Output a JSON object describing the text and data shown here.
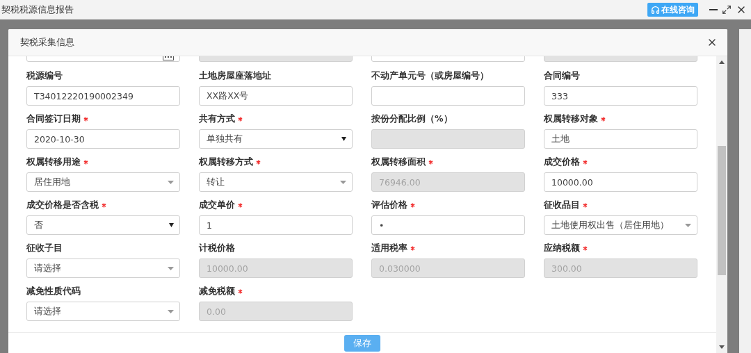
{
  "window": {
    "title": "契税税源信息报告",
    "consult_button": "在线咨询"
  },
  "dialog": {
    "title": "契税采集信息",
    "cut_off_fields": [
      {
        "kind": "date",
        "disabled": false
      },
      {
        "kind": "text",
        "disabled": true
      },
      {
        "kind": "text",
        "disabled": false
      },
      {
        "kind": "text",
        "disabled": true
      }
    ],
    "fields": [
      {
        "label": "税源编号",
        "required": false,
        "kind": "text",
        "value": "T34012220190002349",
        "disabled": false
      },
      {
        "label": "土地房屋座落地址",
        "required": false,
        "kind": "text",
        "value": "XX路XX号",
        "disabled": false
      },
      {
        "label": "不动产单元号（或房屋编号）",
        "required": false,
        "kind": "text",
        "disabled": false
      },
      {
        "label": "合同编号",
        "required": false,
        "kind": "text",
        "value": "333",
        "disabled": false
      },
      {
        "label": "合同签订日期",
        "required": true,
        "kind": "text",
        "value": "2020-10-30",
        "disabled": false
      },
      {
        "label": "共有方式",
        "required": true,
        "kind": "native-select",
        "value": "单独共有",
        "disabled": false
      },
      {
        "label": "按份分配比例（%）",
        "required": false,
        "kind": "text",
        "disabled": true
      },
      {
        "label": "权属转移对象",
        "required": true,
        "kind": "text",
        "value": "土地",
        "disabled": false
      },
      {
        "label": "权属转移用途",
        "required": true,
        "kind": "select",
        "value": "居住用地",
        "disabled": false
      },
      {
        "label": "权属转移方式",
        "required": true,
        "kind": "select",
        "value": "转让",
        "disabled": false
      },
      {
        "label": "权属转移面积",
        "required": true,
        "kind": "text",
        "value": "76946.00",
        "disabled": true
      },
      {
        "label": "成交价格",
        "required": true,
        "kind": "text",
        "value": "10000.00",
        "disabled": false
      },
      {
        "label": "成交价格是否含税",
        "required": true,
        "kind": "native-select",
        "value": "否",
        "disabled": false
      },
      {
        "label": "成交单价",
        "required": true,
        "kind": "text",
        "value": "1",
        "disabled": false
      },
      {
        "label": "评估价格",
        "required": true,
        "kind": "text",
        "value": "•",
        "disabled": false
      },
      {
        "label": "征收品目",
        "required": true,
        "kind": "select",
        "value": "土地使用权出售（居住用地）",
        "disabled": false
      },
      {
        "label": "征收子目",
        "required": false,
        "kind": "select",
        "value": "请选择",
        "disabled": false
      },
      {
        "label": "计税价格",
        "required": false,
        "kind": "text",
        "value": "10000.00",
        "disabled": true
      },
      {
        "label": "适用税率",
        "required": true,
        "kind": "text",
        "value": "0.030000",
        "disabled": true
      },
      {
        "label": "应纳税额",
        "required": true,
        "kind": "text",
        "value": "300.00",
        "disabled": true
      },
      {
        "label": "减免性质代码",
        "required": false,
        "kind": "select",
        "value": "请选择",
        "disabled": false
      },
      {
        "label": "减免税额",
        "required": true,
        "kind": "text",
        "value": "0.00",
        "disabled": true
      }
    ],
    "save_button": "保存"
  }
}
